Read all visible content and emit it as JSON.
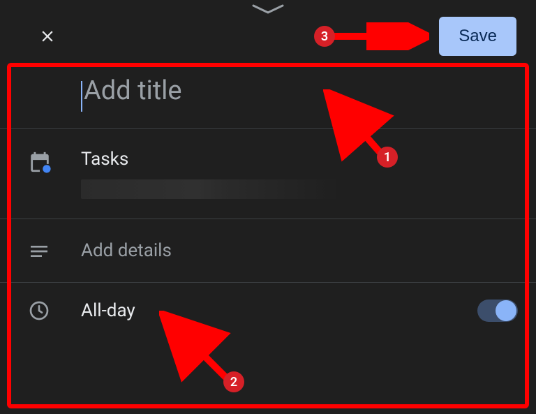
{
  "header": {
    "save_label": "Save"
  },
  "title": {
    "placeholder": "Add title",
    "value": ""
  },
  "list": {
    "label": "Tasks"
  },
  "details": {
    "placeholder": "Add details"
  },
  "allday": {
    "label": "All-day",
    "enabled": true
  },
  "annotations": {
    "1": "1",
    "2": "2",
    "3": "3"
  },
  "colors": {
    "accent": "#8ab4f8",
    "save_bg": "#a8c7fa",
    "annotation": "#ff0000"
  }
}
